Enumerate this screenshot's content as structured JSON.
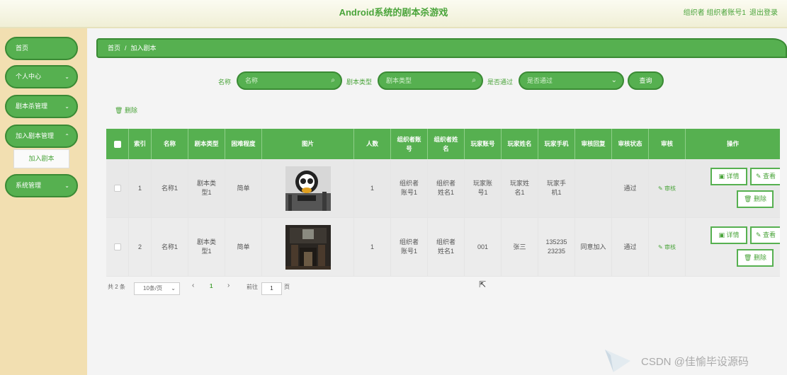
{
  "header": {
    "title": "Android系统的剧本杀游戏",
    "user": "组织者 组织者账号1",
    "logout": "退出登录"
  },
  "sidebar": {
    "items": [
      {
        "label": "首页",
        "chev": ""
      },
      {
        "label": "个人中心",
        "chev": "⌄"
      },
      {
        "label": "剧本杀管理",
        "chev": "⌄"
      },
      {
        "label": "加入剧本管理",
        "chev": "⌃"
      },
      {
        "label": "系统管理",
        "chev": "⌄"
      }
    ],
    "sub_item": "加入剧本"
  },
  "breadcrumb": {
    "home": "首页",
    "sep": "/",
    "current": "加入剧本"
  },
  "search": {
    "name_label": "名称",
    "name_placeholder": "名称",
    "type_label": "剧本类型",
    "type_placeholder": "剧本类型",
    "pass_label": "是否通过",
    "pass_placeholder": "是否通过",
    "query_button": "查询",
    "search_icon": "⌕",
    "select_icon": "⌄"
  },
  "delete_button": "删除",
  "table": {
    "headers": [
      "",
      "索引",
      "名称",
      "剧本类型",
      "困难程度",
      "图片",
      "人数",
      "组织者账号",
      "组织者姓名",
      "玩家账号",
      "玩家姓名",
      "玩家手机",
      "审核回复",
      "审核状态",
      "审核",
      "操作"
    ],
    "rows": [
      {
        "index": "1",
        "name": "名称1",
        "type": "剧本类型1",
        "difficulty": "简单",
        "count": "1",
        "org_account": "组织者账号1",
        "org_name": "组织者姓名1",
        "player_account": "玩家账号1",
        "player_name": "玩家姓名1",
        "player_phone": "玩家手机1",
        "reply": "",
        "status": "通过",
        "audit": "审核"
      },
      {
        "index": "2",
        "name": "名称1",
        "type": "剧本类型1",
        "difficulty": "简单",
        "count": "1",
        "org_account": "组织者账号1",
        "org_name": "组织者姓名1",
        "player_account": "001",
        "player_name": "张三",
        "player_phone": "13523523235",
        "reply": "同意加入",
        "status": "通过",
        "audit": "审核"
      }
    ],
    "ops": {
      "detail": "详情",
      "view": "查看",
      "delete": "删除"
    },
    "ops_icons": {
      "detail": "▣",
      "view": "✎",
      "delete": "🗑",
      "audit": "✎"
    }
  },
  "pagination": {
    "total": "共 2 条",
    "page_size": "10条/页",
    "prev": "‹",
    "current": "1",
    "next": "›",
    "goto_label": "前往",
    "goto_value": "1",
    "goto_suffix": "页"
  },
  "watermark": "CSDN @佳愉毕设源码",
  "colors": {
    "primary": "#56b050",
    "primary_dark": "#3a8a34",
    "sidebar_bg": "#f2dfb1"
  }
}
